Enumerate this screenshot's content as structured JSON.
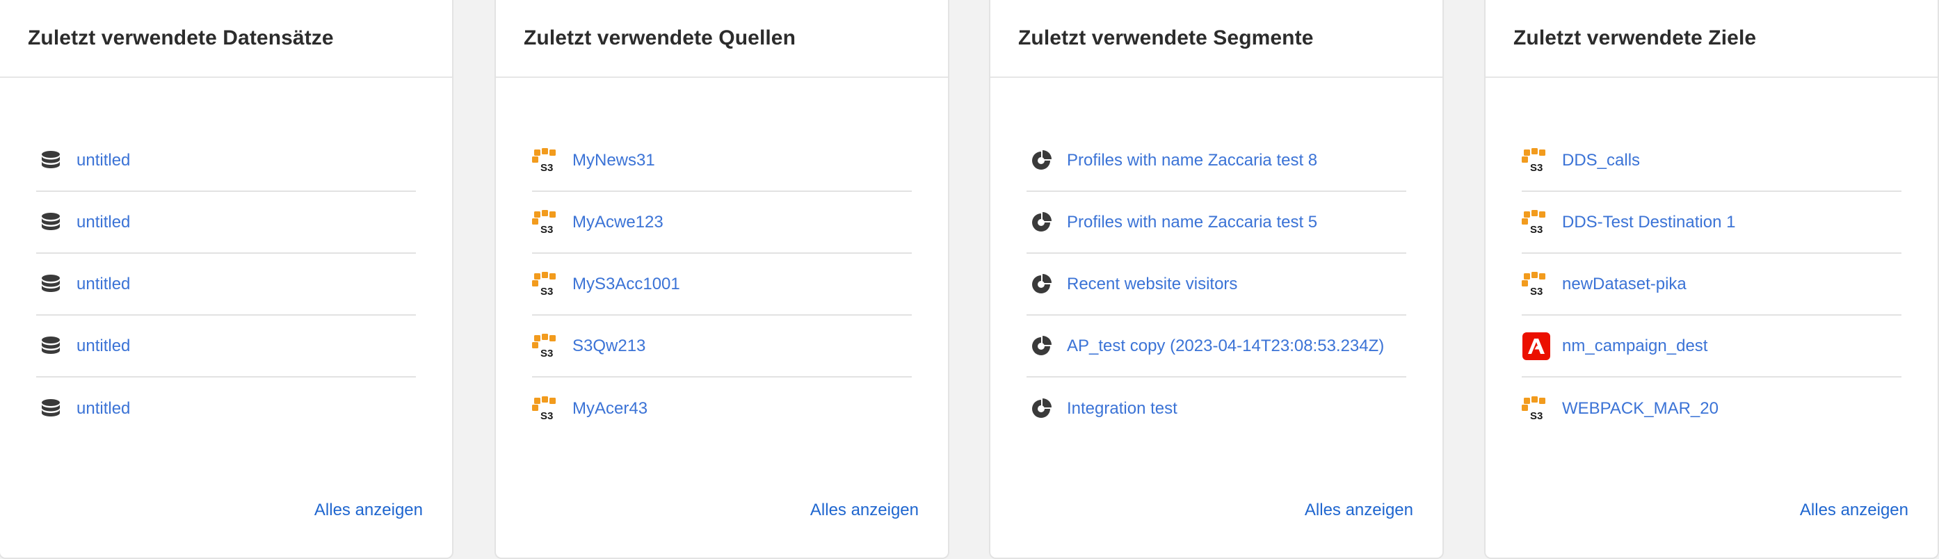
{
  "cards": [
    {
      "title": "Zuletzt verwendete Datensätze",
      "view_all": "Alles anzeigen",
      "items": [
        {
          "label": "untitled",
          "icon": "database-icon"
        },
        {
          "label": "untitled",
          "icon": "database-icon"
        },
        {
          "label": "untitled",
          "icon": "database-icon"
        },
        {
          "label": "untitled",
          "icon": "database-icon"
        },
        {
          "label": "untitled",
          "icon": "database-icon"
        }
      ]
    },
    {
      "title": "Zuletzt verwendete Quellen",
      "view_all": "Alles anzeigen",
      "items": [
        {
          "label": "MyNews31",
          "icon": "amazon-s3-icon"
        },
        {
          "label": "MyAcwe123",
          "icon": "amazon-s3-icon"
        },
        {
          "label": "MyS3Acc1001",
          "icon": "amazon-s3-icon"
        },
        {
          "label": "S3Qw213",
          "icon": "amazon-s3-icon"
        },
        {
          "label": "MyAcer43",
          "icon": "amazon-s3-icon"
        }
      ]
    },
    {
      "title": "Zuletzt verwendete Segmente",
      "view_all": "Alles anzeigen",
      "items": [
        {
          "label": "Profiles with name Zaccaria test 8",
          "icon": "segment-icon"
        },
        {
          "label": "Profiles with name Zaccaria test 5",
          "icon": "segment-icon"
        },
        {
          "label": "Recent website visitors",
          "icon": "segment-icon"
        },
        {
          "label": "AP_test copy (2023-04-14T23:08:53.234Z)",
          "icon": "segment-icon"
        },
        {
          "label": "Integration test",
          "icon": "segment-icon"
        }
      ]
    },
    {
      "title": "Zuletzt verwendete Ziele",
      "view_all": "Alles anzeigen",
      "items": [
        {
          "label": "DDS_calls",
          "icon": "amazon-s3-icon"
        },
        {
          "label": "DDS-Test Destination 1",
          "icon": "amazon-s3-icon"
        },
        {
          "label": "newDataset-pika",
          "icon": "amazon-s3-icon"
        },
        {
          "label": "nm_campaign_dest",
          "icon": "adobe-icon"
        },
        {
          "label": "WEBPACK_MAR_20",
          "icon": "amazon-s3-icon"
        }
      ]
    }
  ],
  "icon_labels": {
    "s3_text": "S3"
  },
  "colors": {
    "link": "#3b73d6",
    "view_all": "#1f66cf",
    "s3_orange": "#f29b1d",
    "adobe_red": "#eb1000",
    "icon_dark": "#3a3a3a"
  }
}
